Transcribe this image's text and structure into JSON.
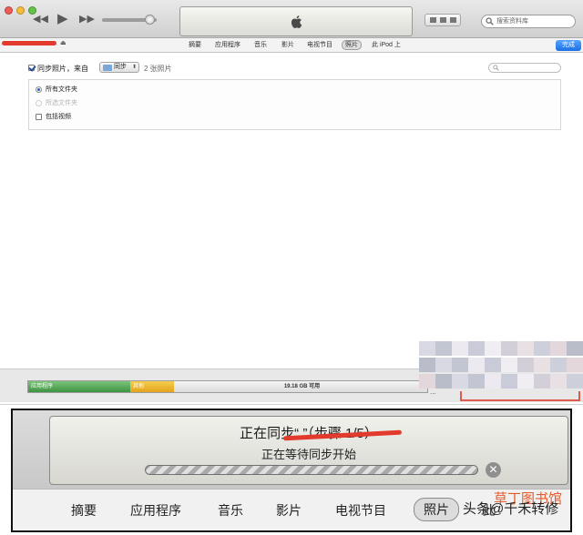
{
  "toolbar": {
    "search_placeholder": "搜索资料库",
    "rewind_glyph": "◀◀",
    "play_glyph": "▶",
    "forward_glyph": "▶▶",
    "icons": [
      "apple-icon",
      "search-icon",
      "view-icon"
    ]
  },
  "device": {
    "eject_glyph": "⏏"
  },
  "tabs": {
    "items": [
      {
        "label": "摘要"
      },
      {
        "label": "应用程序"
      },
      {
        "label": "音乐"
      },
      {
        "label": "影片"
      },
      {
        "label": "电视节目"
      },
      {
        "label": "照片",
        "active": true
      },
      {
        "label": "此 iPod 上"
      }
    ],
    "done_label": "完成"
  },
  "photos": {
    "sync_label": "同步照片，来自",
    "folder_value": "同步",
    "folder_arrows": "⬍",
    "count_label": "2 张照片",
    "options": [
      {
        "label": "所有文件夹",
        "selected": true
      },
      {
        "label": "所选文件夹",
        "selected": false,
        "disabled": true
      },
      {
        "label": "包括视频",
        "checkbox": true,
        "checked": false
      }
    ]
  },
  "capacity": {
    "apps_label": "应用程序",
    "other_label": "其他",
    "free_label": "19.18 GB 可用",
    "colors": {
      "apps": "#5aac5a",
      "other": "#eebc34",
      "free": "#e6e6e6"
    }
  },
  "footer": {
    "dots": "..."
  },
  "zoom": {
    "title": "正在同步“          ”（步骤 1/5）",
    "subtitle": "正在等待同步开始",
    "cancel_glyph": "✕",
    "tabs": [
      {
        "label": "摘要"
      },
      {
        "label": "应用程序"
      },
      {
        "label": "音乐"
      },
      {
        "label": "影片"
      },
      {
        "label": "电视节目"
      },
      {
        "label": "照片",
        "active": true
      },
      {
        "label": "此"
      }
    ]
  },
  "watermark": {
    "brand": "草丁图书馆",
    "text": "头条@千禾转修"
  }
}
